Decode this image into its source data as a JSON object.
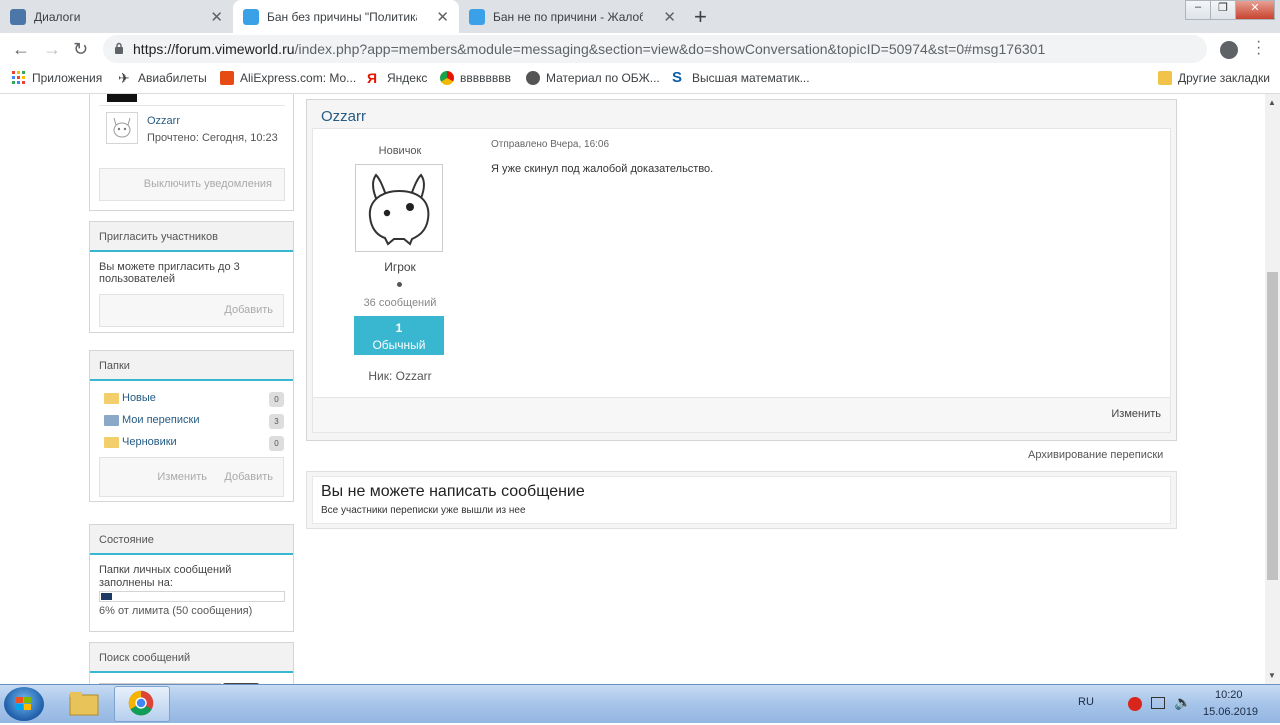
{
  "browser": {
    "tabs": [
      {
        "title": "Диалоги",
        "active": false,
        "fav_color": "#4a76a8"
      },
      {
        "title": "Бан без причины \"Политика\" - V",
        "active": true,
        "fav_color": "#3aa1e8"
      },
      {
        "title": "Бан не по причини - Жалобы на",
        "active": false,
        "fav_color": "#3aa1e8"
      }
    ],
    "new_tab": "+",
    "url_host": "https://forum.vimeworld.ru",
    "url_rest": "/index.php?app=members&module=messaging&section=view&do=showConversation&topicID=50974&st=0#msg176301",
    "bookmarks": [
      {
        "label": "Приложения",
        "icon": "apps-grid-icon",
        "color": "#e94235"
      },
      {
        "label": "Авиабилеты",
        "icon": "plane-icon",
        "color": "#222222"
      },
      {
        "label": "AliExpress.com: Мо...",
        "icon": "aliexpress-icon",
        "color": "#e64b14"
      },
      {
        "label": "Яндекс",
        "icon": "yandex-icon",
        "color": "#e61400"
      },
      {
        "label": "вввввввв",
        "icon": "colorful-circle-icon",
        "color": "#f2b800"
      },
      {
        "label": "Материал по ОБЖ...",
        "icon": "globe-icon",
        "color": "#555555"
      },
      {
        "label": "Высшая математик...",
        "icon": "s-icon",
        "color": "#0f5ea8"
      }
    ],
    "other_bookmarks": "Другие закладки"
  },
  "sidebar": {
    "participant": {
      "name": "Ozzarr",
      "read": "Прочтено: Сегодня, 10:23"
    },
    "disable_notifications": "Выключить уведомления",
    "invite": {
      "title": "Пригласить участников",
      "text": "Вы можете пригласить до 3 пользователей",
      "button": "Добавить"
    },
    "folders": {
      "title": "Папки",
      "items": [
        {
          "label": "Новые",
          "count": "0"
        },
        {
          "label": "Мои переписки",
          "count": "3"
        },
        {
          "label": "Черновики",
          "count": "0"
        }
      ],
      "edit": "Изменить",
      "add": "Добавить"
    },
    "status": {
      "title": "Состояние",
      "text": "Папки личных сообщений заполнены на:",
      "percent_filled": 6,
      "limit_text": "6% от лимита (50 сообщения)"
    },
    "search": {
      "title": "Поиск сообщений"
    }
  },
  "post": {
    "author": "Ozzarr",
    "rank": "Новичок",
    "group": "Игрок",
    "posts_count": "36 сообщений",
    "rep_value": "1",
    "rep_label": "Обычный",
    "nick": "Ник: Ozzarr",
    "sent": "Отправлено Вчера, 16:06",
    "text": "Я уже скинул под жалобой доказательство.",
    "edit": "Изменить"
  },
  "archive_link": "Архивирование переписки",
  "cannot": {
    "title": "Вы не можете написать сообщение",
    "subtitle": "Все участники переписки уже вышли из нее"
  },
  "taskbar": {
    "lang": "RU",
    "time": "10:20",
    "date": "15.06.2019"
  }
}
